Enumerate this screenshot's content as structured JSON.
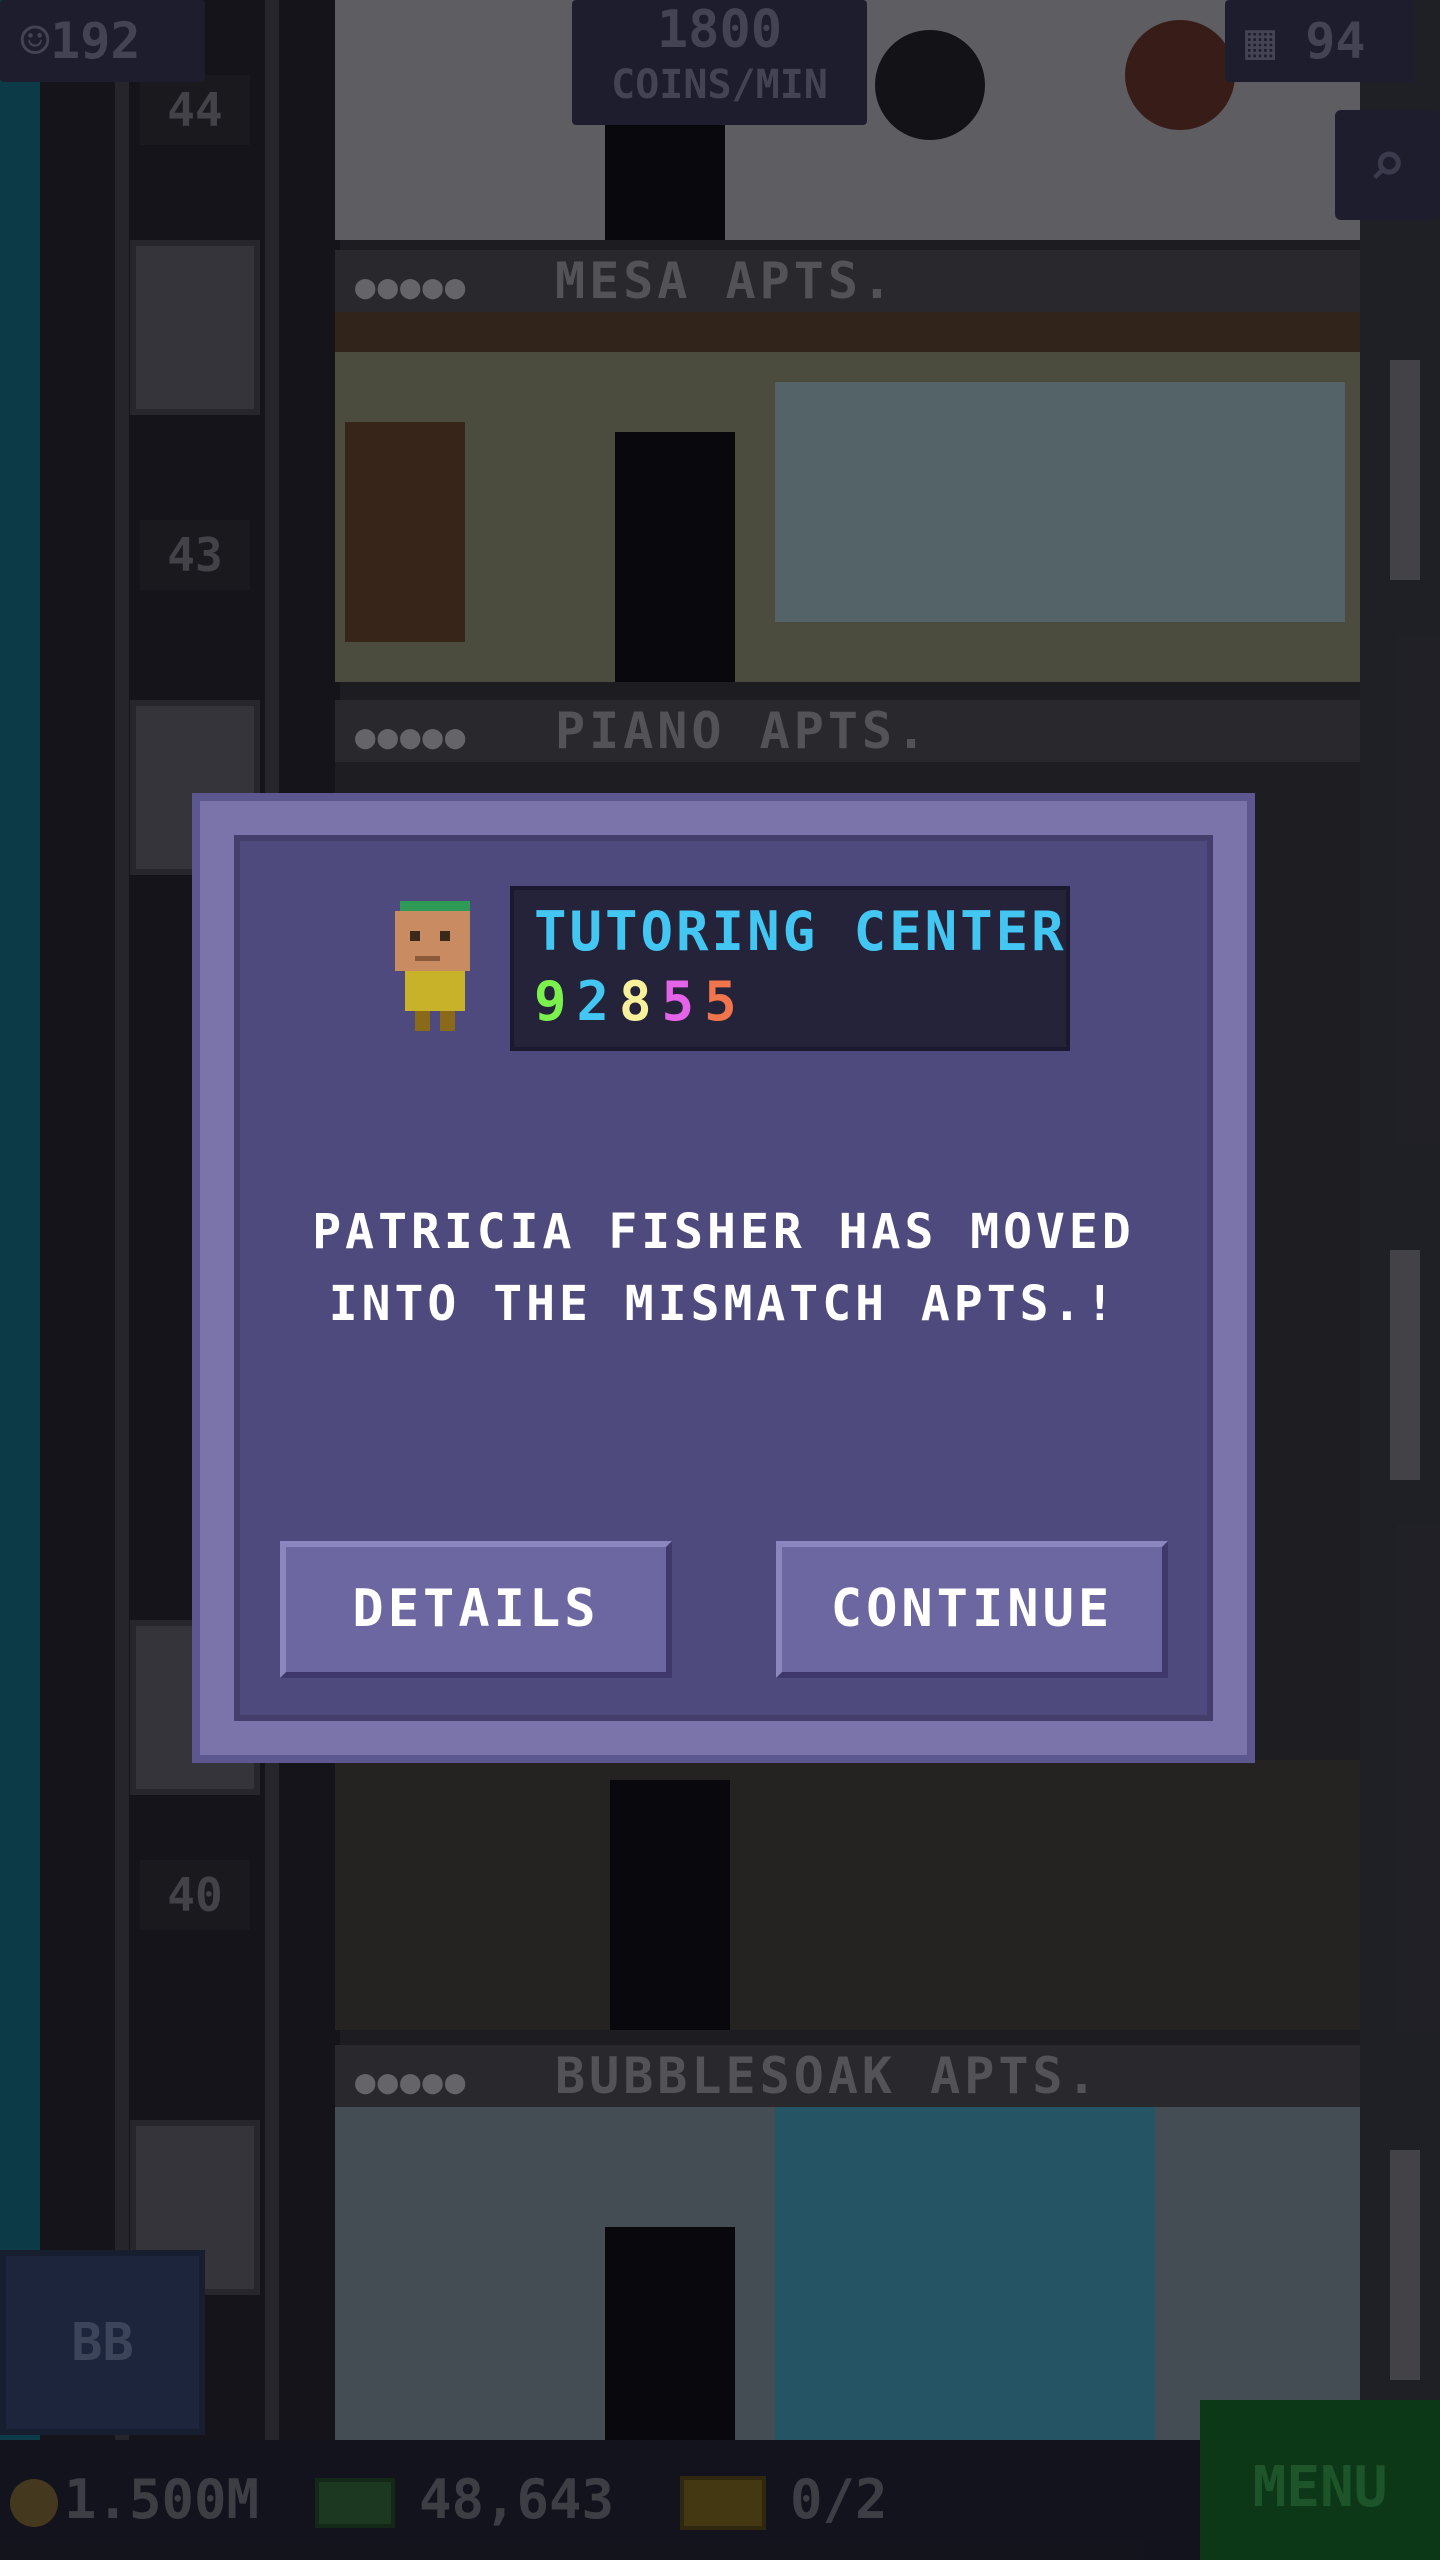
{
  "hud": {
    "population": "192",
    "coins_rate_value": "1800",
    "coins_rate_unit": "COINS/MIN",
    "floors_count": "94",
    "search_icon": "magnifier-icon"
  },
  "tower": {
    "floor_numbers": [
      "44",
      "43",
      "40"
    ],
    "floor_signs": [
      {
        "dots": "●●●●●",
        "name": "MESA APTS."
      },
      {
        "dots": "●●●●●",
        "name": "PIANO APTS."
      },
      {
        "dots": "●●●●●",
        "name": "BUBBLESOAK APTS."
      }
    ]
  },
  "dialog": {
    "header_title": "TUTORING CENTER",
    "code_digits": [
      {
        "d": "9",
        "color": "#7cf04c"
      },
      {
        "d": "2",
        "color": "#44c6f2"
      },
      {
        "d": "8",
        "color": "#f6f19a"
      },
      {
        "d": "5",
        "color": "#e464e8"
      },
      {
        "d": "5",
        "color": "#f0744c"
      }
    ],
    "message_line1": "PATRICIA FISHER HAS MOVED",
    "message_line2": "INTO THE MISMATCH APTS.!",
    "details_label": "DETAILS",
    "continue_label": "CONTINUE"
  },
  "bottom": {
    "coins": "1.500M",
    "bux": "48,643",
    "tickets": "0/2",
    "menu_label": "MENU",
    "bb_label": "BB"
  }
}
